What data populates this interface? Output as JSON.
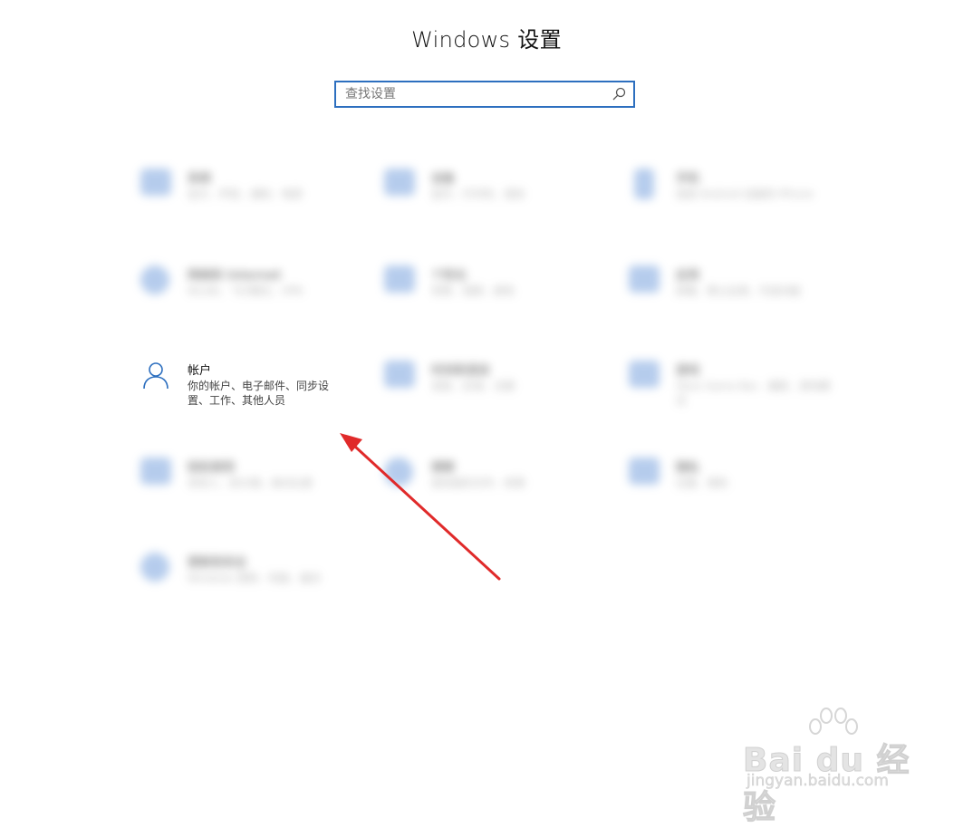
{
  "window": {
    "title": "Windows 设置"
  },
  "search": {
    "placeholder": "查找设置"
  },
  "tiles": [
    {
      "id": "system",
      "label": "系统",
      "desc": "显示、声音、通知、电源"
    },
    {
      "id": "devices",
      "label": "设备",
      "desc": "蓝牙、打印机、鼠标"
    },
    {
      "id": "phone",
      "label": "手机",
      "desc": "连接 Android 设备和 iPhone"
    },
    {
      "id": "network",
      "label": "网络和 Internet",
      "desc": "WLAN、飞行模式、VPN"
    },
    {
      "id": "personalization",
      "label": "个性化",
      "desc": "背景、锁屏、颜色"
    },
    {
      "id": "apps",
      "label": "应用",
      "desc": "卸载、默认应用、可选功能"
    },
    {
      "id": "accounts",
      "label": "帐户",
      "desc": "你的帐户、电子邮件、同步设置、工作、其他人员"
    },
    {
      "id": "time-language",
      "label": "时间和语言",
      "desc": "语音、区域、日期"
    },
    {
      "id": "gaming",
      "label": "游戏",
      "desc": "Xbox Game Bar、捕获、游戏模式"
    },
    {
      "id": "ease-of-access",
      "label": "轻松使用",
      "desc": "讲述人、放大镜、高对比度"
    },
    {
      "id": "search",
      "label": "搜索",
      "desc": "查找我的文件、权限"
    },
    {
      "id": "privacy",
      "label": "隐私",
      "desc": "位置、相机"
    },
    {
      "id": "update-security",
      "label": "更新和安全",
      "desc": "Windows 更新、恢复、备份"
    }
  ],
  "watermark": {
    "brand": "Bai du 经验",
    "url": "jingyan.baidu.com"
  },
  "colors": {
    "accent": "#2d6fbf",
    "annotation_arrow": "#e02a2a"
  }
}
